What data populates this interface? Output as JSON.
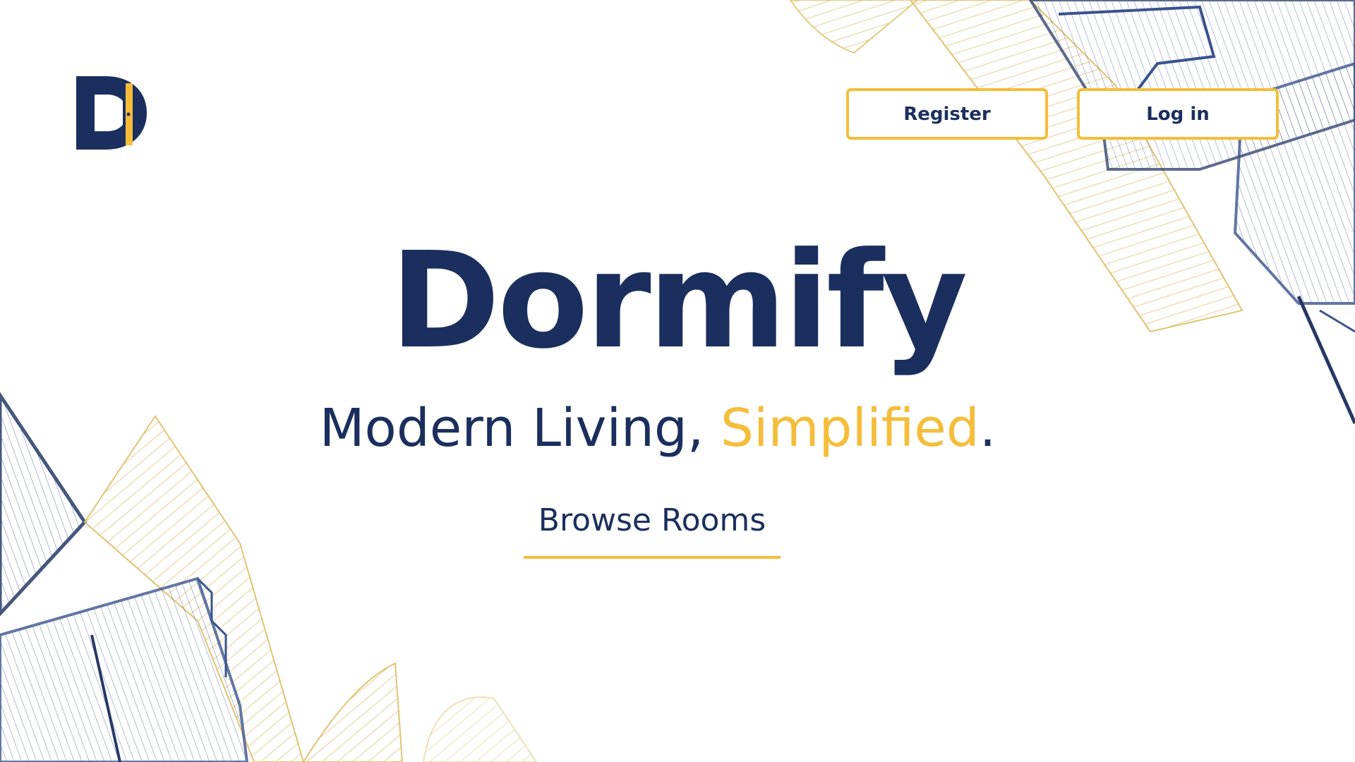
{
  "brand": {
    "logo_icon": "dormify-door-logo-icon",
    "name": "Dormify",
    "colors": {
      "navy": "#1b2f5e",
      "gold": "#f5bd3a",
      "blueprint_blue": "#2f4a86"
    }
  },
  "header": {
    "register_label": "Register",
    "login_label": "Log in"
  },
  "hero": {
    "title": "Dormify",
    "tagline_main": "Modern Living, ",
    "tagline_accent": "Simplified",
    "tagline_end": ".",
    "cta_label": "Browse Rooms"
  },
  "background": {
    "decoration_icon": "blueprint-floorplan-illustration"
  }
}
